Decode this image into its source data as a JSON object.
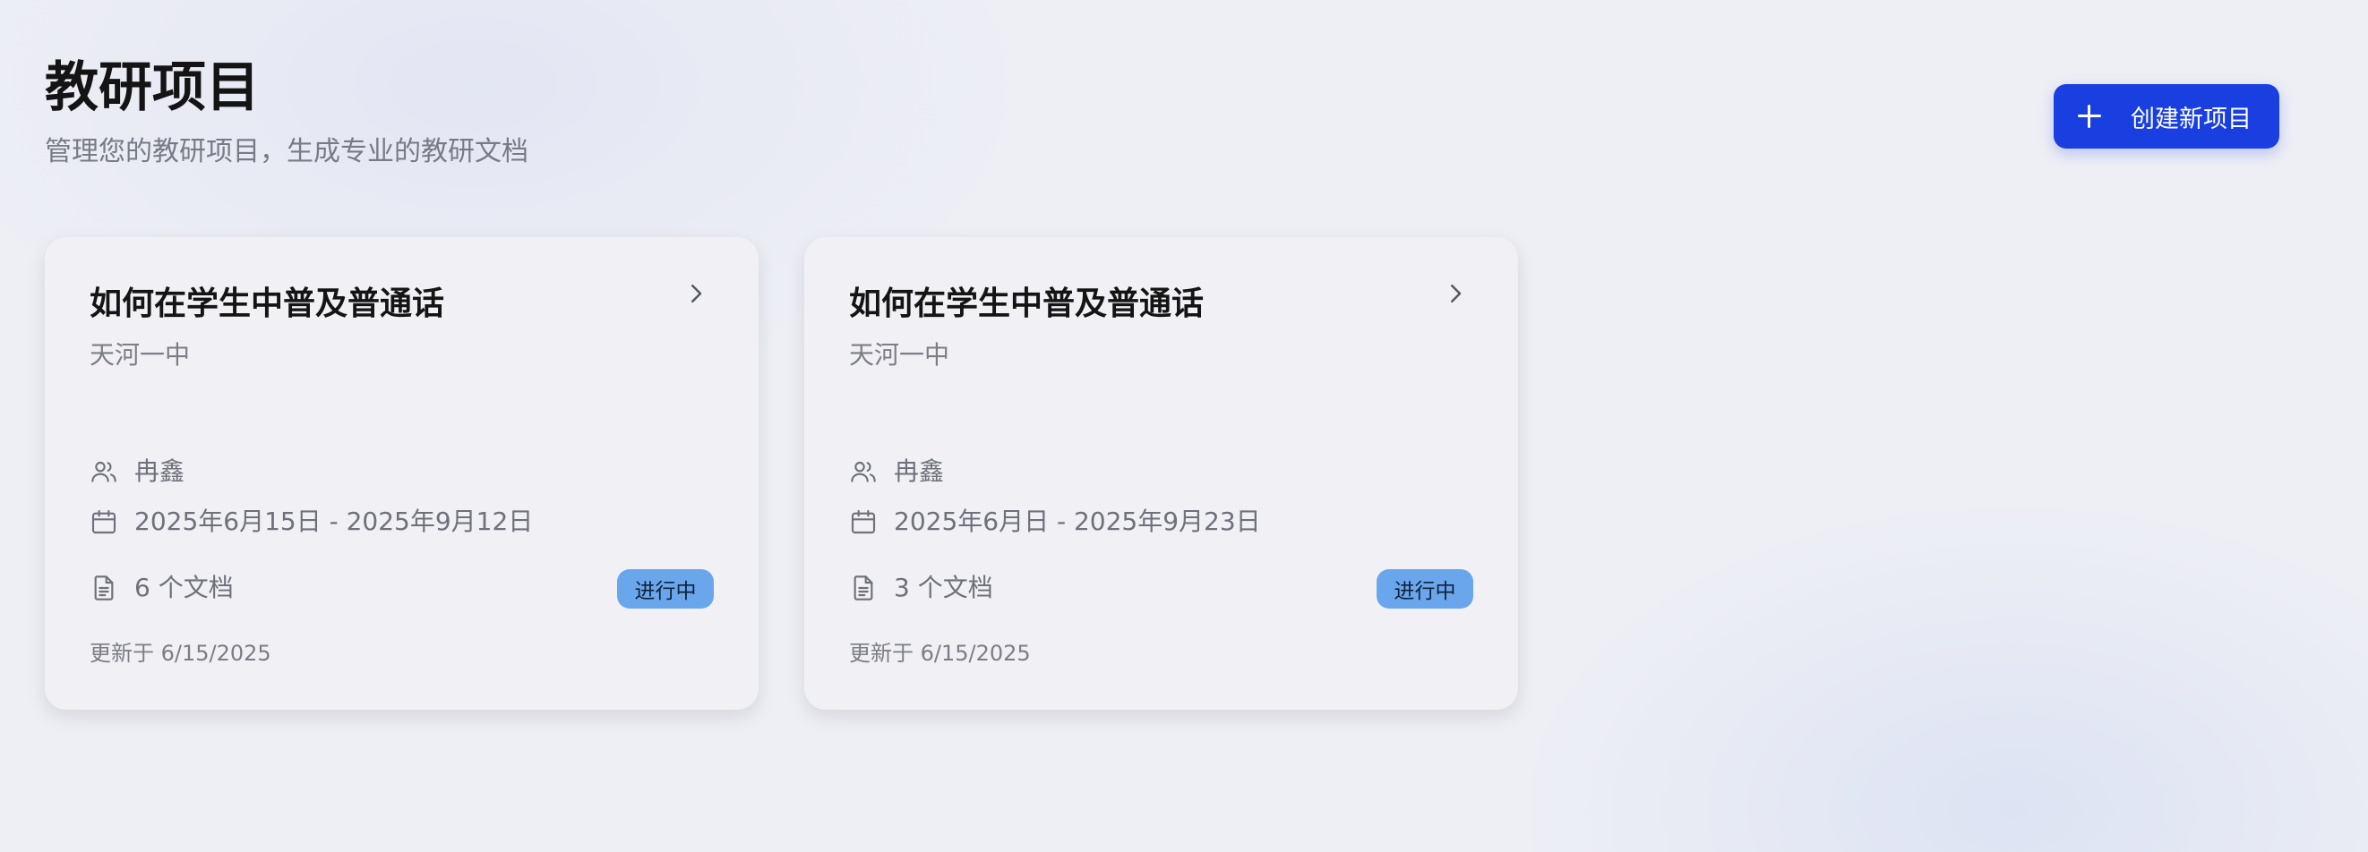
{
  "header": {
    "title": "教研项目",
    "subtitle": "管理您的教研项目，生成专业的教研文档"
  },
  "toolbar": {
    "create_label": "创建新项目"
  },
  "projects": [
    {
      "title": "如何在学生中普及普通话",
      "school": "天河一中",
      "owner": "冉鑫",
      "dates": "2025年6月15日 - 2025年9月12日",
      "docs": "6 个文档",
      "status": "进行中",
      "updated": "更新于 6/15/2025"
    },
    {
      "title": "如何在学生中普及普通话",
      "school": "天河一中",
      "owner": "冉鑫",
      "dates": "2025年6月日 - 2025年9月23日",
      "docs": "3 个文档",
      "status": "进行中",
      "updated": "更新于 6/15/2025"
    }
  ],
  "colors": {
    "accent": "#1a3fe0",
    "status_badge": "#6aa6ec"
  },
  "icons": [
    "plus-icon",
    "chevron-right-icon",
    "users-icon",
    "calendar-icon",
    "document-icon"
  ]
}
